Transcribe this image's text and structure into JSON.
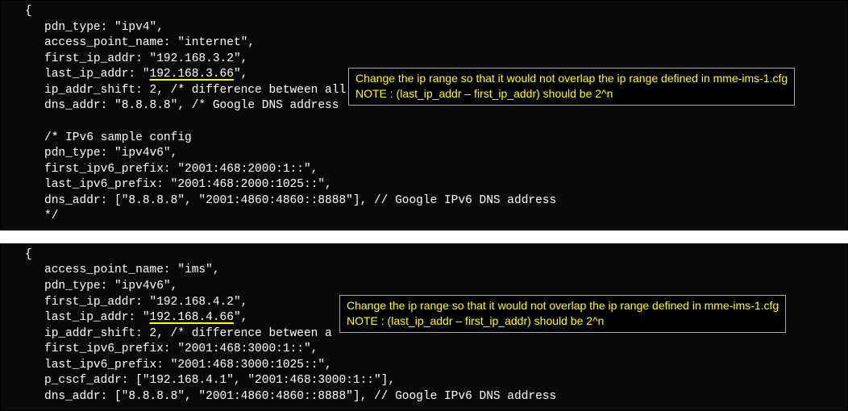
{
  "block_a": {
    "l1": "{",
    "l2": "pdn_type: \"ipv4\",",
    "l3": "access_point_name: \"internet\",",
    "l4": "first_ip_addr: \"192.168.3.2\",",
    "l5a": "last_ip_addr: \"",
    "l5b": "192.168.3.66",
    "l5c": "\",",
    "l6": "ip_addr_shift: 2, /* difference between all",
    "l7": "dns_addr: \"8.8.8.8\", /* Google DNS address ",
    "l8": " ",
    "l9": "/* IPv6 sample config",
    "l10": "pdn_type: \"ipv4v6\",",
    "l11": "first_ipv6_prefix: \"2001:468:2000:1::\",",
    "l12": "last_ipv6_prefix: \"2001:468:2000:1025::\",",
    "l13": "dns_addr: [\"8.8.8.8\", \"2001:4860:4860::8888\"], // Google IPv6 DNS address",
    "l14": "*/"
  },
  "callout_a": {
    "line1": "Change the ip range so that it would not overlap the ip range defined in mme-ims-1.cfg",
    "line2": "NOTE : (last_ip_addr – first_ip_addr) should be 2^n"
  },
  "block_b": {
    "l1": "{",
    "l2": "access_point_name: \"ims\",",
    "l3": "pdn_type: \"ipv4v6\",",
    "l4": "first_ip_addr: \"192.168.4.2\",",
    "l5a": "last_ip_addr: \"",
    "l5b": "192.168.4.66",
    "l5c": "\",",
    "l6": "ip_addr_shift: 2, /* difference between a",
    "l7": "first_ipv6_prefix: \"2001:468:3000:1::\",",
    "l8": "last_ipv6_prefix: \"2001:468:3000:1025::\",",
    "l9": "p_cscf_addr: [\"192.168.4.1\", \"2001:468:3000:1::\"],",
    "l10": "dns_addr: [\"8.8.8.8\", \"2001:4860:4860::8888\"], // Google IPv6 DNS address"
  },
  "callout_b": {
    "line1": "Change the ip range so that it would not overlap the ip range defined in mme-ims-1.cfg",
    "line2": "NOTE : (last_ip_addr – first_ip_addr) should be 2^n"
  }
}
